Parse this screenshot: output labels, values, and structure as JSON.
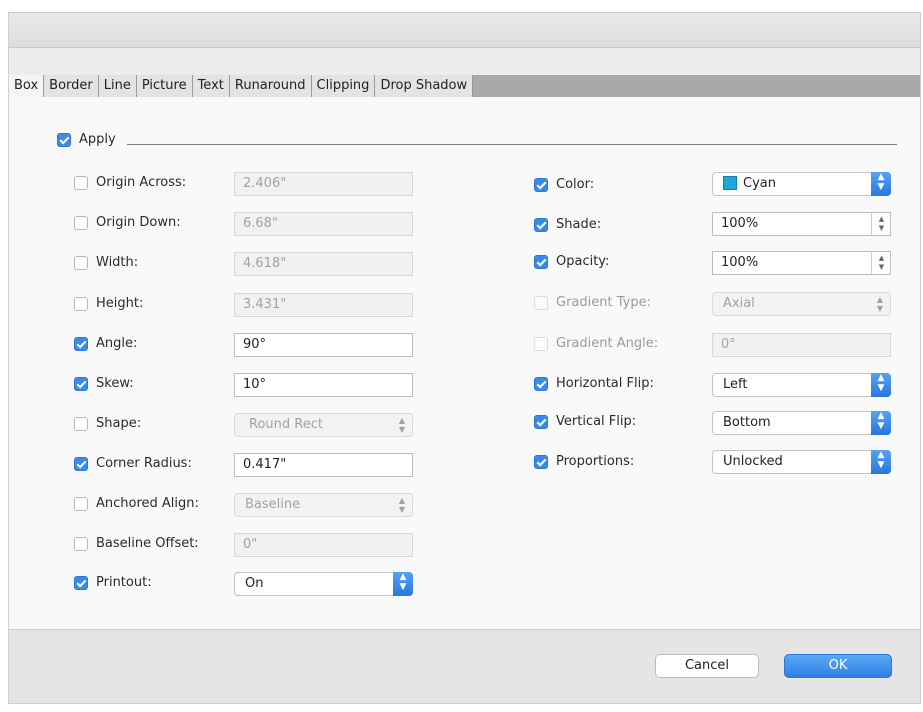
{
  "tabs": [
    "Box",
    "Border",
    "Line",
    "Picture",
    "Text",
    "Runaround",
    "Clipping",
    "Drop Shadow"
  ],
  "apply": {
    "label": "Apply",
    "checked": true
  },
  "left": {
    "origin_across": {
      "label": "Origin Across:",
      "value": "2.406\"",
      "checked": false
    },
    "origin_down": {
      "label": "Origin Down:",
      "value": "6.68\"",
      "checked": false
    },
    "width": {
      "label": "Width:",
      "value": "4.618\"",
      "checked": false
    },
    "height": {
      "label": "Height:",
      "value": "3.431\"",
      "checked": false
    },
    "angle": {
      "label": "Angle:",
      "value": "90°",
      "checked": true
    },
    "skew": {
      "label": "Skew:",
      "value": "10°",
      "checked": true
    },
    "shape": {
      "label": "Shape:",
      "value": "Round Rect",
      "checked": false
    },
    "corner_radius": {
      "label": "Corner Radius:",
      "value": "0.417\"",
      "checked": true
    },
    "anchored_align": {
      "label": "Anchored Align:",
      "value": "Baseline",
      "checked": false
    },
    "baseline_offset": {
      "label": "Baseline Offset:",
      "value": "0\"",
      "checked": false
    },
    "printout": {
      "label": "Printout:",
      "value": "On",
      "checked": true
    }
  },
  "right": {
    "color": {
      "label": "Color:",
      "value": "Cyan",
      "swatch": "#1ea7d8",
      "checked": true
    },
    "shade": {
      "label": "Shade:",
      "value": "100%",
      "checked": true
    },
    "opacity": {
      "label": "Opacity:",
      "value": "100%",
      "checked": true
    },
    "gradient_type": {
      "label": "Gradient Type:",
      "value": "Axial",
      "checked": false
    },
    "gradient_angle": {
      "label": "Gradient Angle:",
      "value": "0°",
      "checked": false
    },
    "horizontal_flip": {
      "label": "Horizontal Flip:",
      "value": "Left",
      "checked": true
    },
    "vertical_flip": {
      "label": "Vertical Flip:",
      "value": "Bottom",
      "checked": true
    },
    "proportions": {
      "label": "Proportions:",
      "value": "Unlocked",
      "checked": true
    }
  },
  "buttons": {
    "cancel": "Cancel",
    "ok": "OK"
  }
}
